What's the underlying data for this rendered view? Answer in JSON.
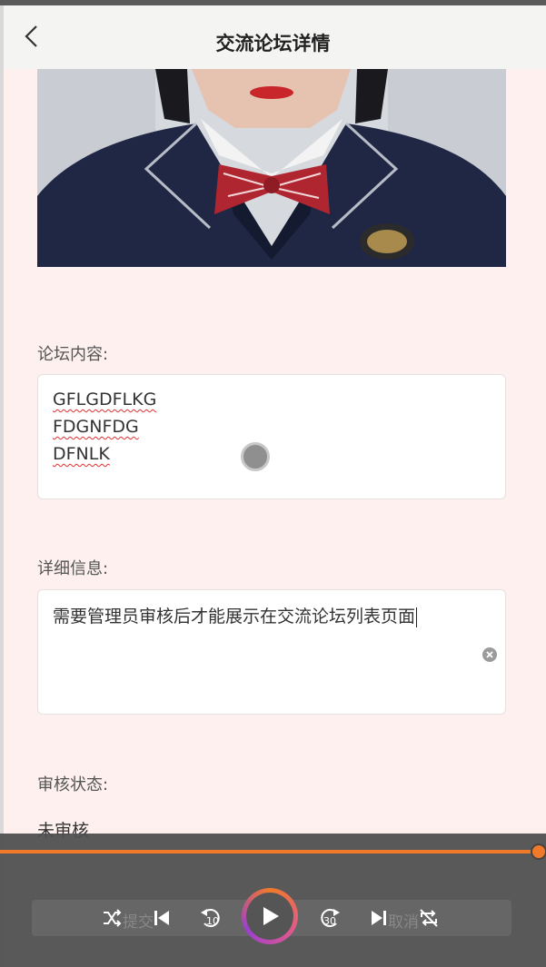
{
  "header": {
    "title": "交流论坛详情",
    "back_icon": "chevron-left-icon"
  },
  "forum_content": {
    "label": "论坛内容:",
    "lines": [
      "GFLGDFLKG",
      "FDGNFDG",
      "DFNLK"
    ]
  },
  "detail": {
    "label": "详细信息:",
    "value": "需要管理员审核后才能展示在交流论坛列表页面"
  },
  "review_status": {
    "label": "审核状态:",
    "value": "未审核"
  },
  "footer_buttons": {
    "submit_label": "提交",
    "cancel_label": "取消"
  },
  "media_player": {
    "progress": 1.0,
    "skip_back_label": "10",
    "skip_forward_label": "30",
    "accent_color": "#f07a2a",
    "icons": [
      "shuffle-icon",
      "previous-icon",
      "rewind-10-icon",
      "play-icon",
      "forward-30-icon",
      "next-icon",
      "repeat-off-icon"
    ]
  }
}
